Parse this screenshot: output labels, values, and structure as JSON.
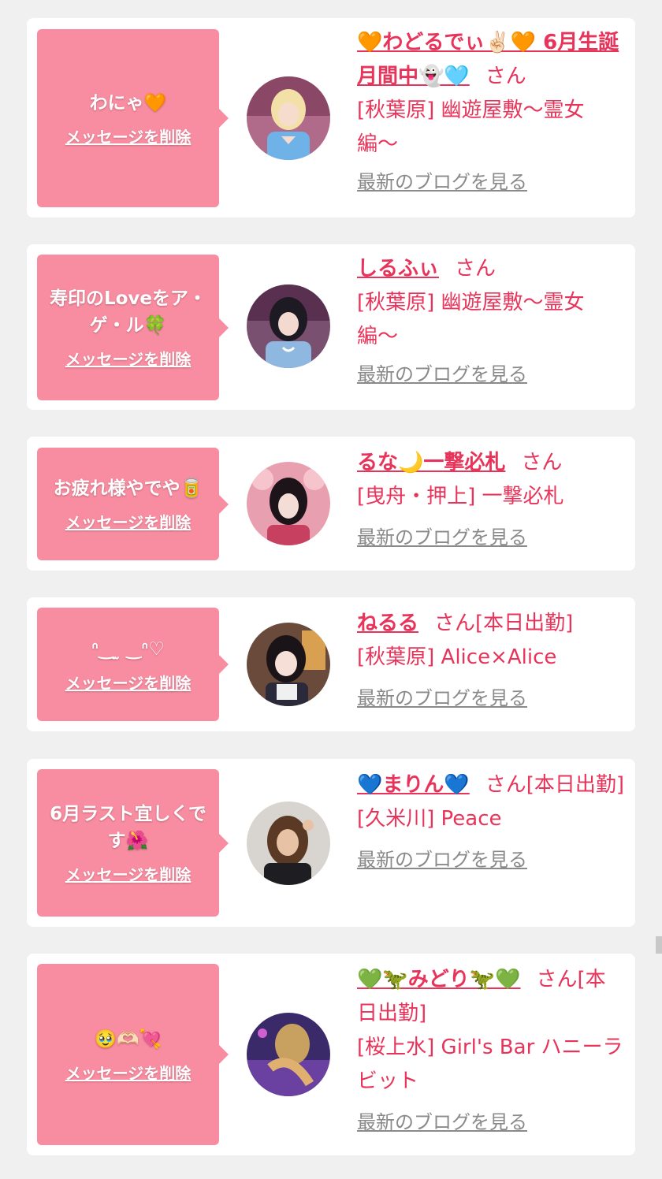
{
  "delete_label": "メッセージを削除",
  "blog_label": "最新のブログを見る",
  "colors": {
    "accent": "#e8345a",
    "bubble": "#f88ca0",
    "card": "#ffffff",
    "background": "#f0f0f0",
    "link_gray": "#8a8a8a"
  },
  "messages": [
    {
      "message": "わにゃ🧡",
      "name": "🧡わどるでぃ✌🏻🧡 6月生誕月間中👻🩵",
      "suffix": "さん",
      "shop": "[秋葉原] 幽遊屋敷〜霊女編〜",
      "avatar": "avatar-photo"
    },
    {
      "message": "寿印のLoveをア・ゲ・ル🍀",
      "name": "しるふぃ",
      "suffix": "さん",
      "shop": "[秋葉原] 幽遊屋敷〜霊女編〜",
      "avatar": "avatar-photo"
    },
    {
      "message": "お疲れ様やでや🥫",
      "name": "るな🌙一撃必札",
      "suffix": "さん",
      "shop": "[曳舟・押上] 一撃必札",
      "avatar": "avatar-photo"
    },
    {
      "message": "ᐢ‿ ̫ ‿ᐢ♡",
      "name": "ねるる",
      "suffix": "さん[本日出勤]",
      "shop": "[秋葉原] Alice×Alice",
      "avatar": "avatar-photo"
    },
    {
      "message": "6月ラスト宜しくです🌺",
      "name": "💙まりん💙",
      "suffix": "さん[本日出勤]",
      "shop": "[久米川] Peace",
      "avatar": "avatar-photo"
    },
    {
      "message": "🥹🫶🏻💘",
      "name": "💚🦖みどり🦖💚",
      "suffix": "さん[本日出勤]",
      "shop": "[桜上水] Girl's Bar ハニーラビット",
      "avatar": "avatar-photo"
    }
  ]
}
